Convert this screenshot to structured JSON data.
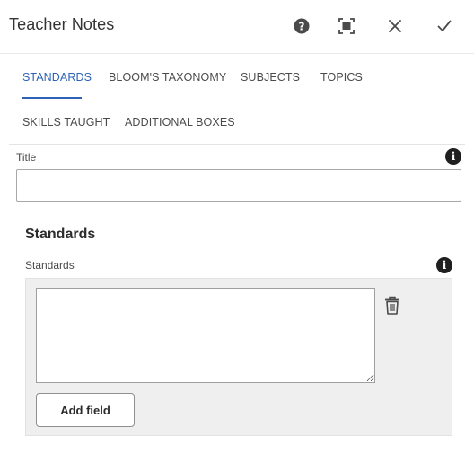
{
  "dialog": {
    "title": "Teacher Notes"
  },
  "header_actions": [
    {
      "name": "help",
      "icon": "help-icon"
    },
    {
      "name": "fullscreen",
      "icon": "fullscreen-icon"
    },
    {
      "name": "close",
      "icon": "close-icon"
    },
    {
      "name": "done",
      "icon": "check-icon"
    }
  ],
  "tabs": [
    {
      "label": "STANDARDS",
      "active": true
    },
    {
      "label": "BLOOM'S TAXONOMY",
      "active": false
    },
    {
      "label": "SUBJECTS",
      "active": false
    },
    {
      "label": "TOPICS",
      "active": false
    },
    {
      "label": "SKILLS TAUGHT",
      "active": false
    },
    {
      "label": "ADDITIONAL BOXES",
      "active": false
    }
  ],
  "form": {
    "title_label": "Title",
    "title_value": "",
    "section_heading": "Standards",
    "standards_label": "Standards",
    "standards_value": "",
    "add_field_label": "Add field"
  },
  "colors": {
    "accent": "#2d63b6",
    "multifield_bg": "#efefef"
  }
}
